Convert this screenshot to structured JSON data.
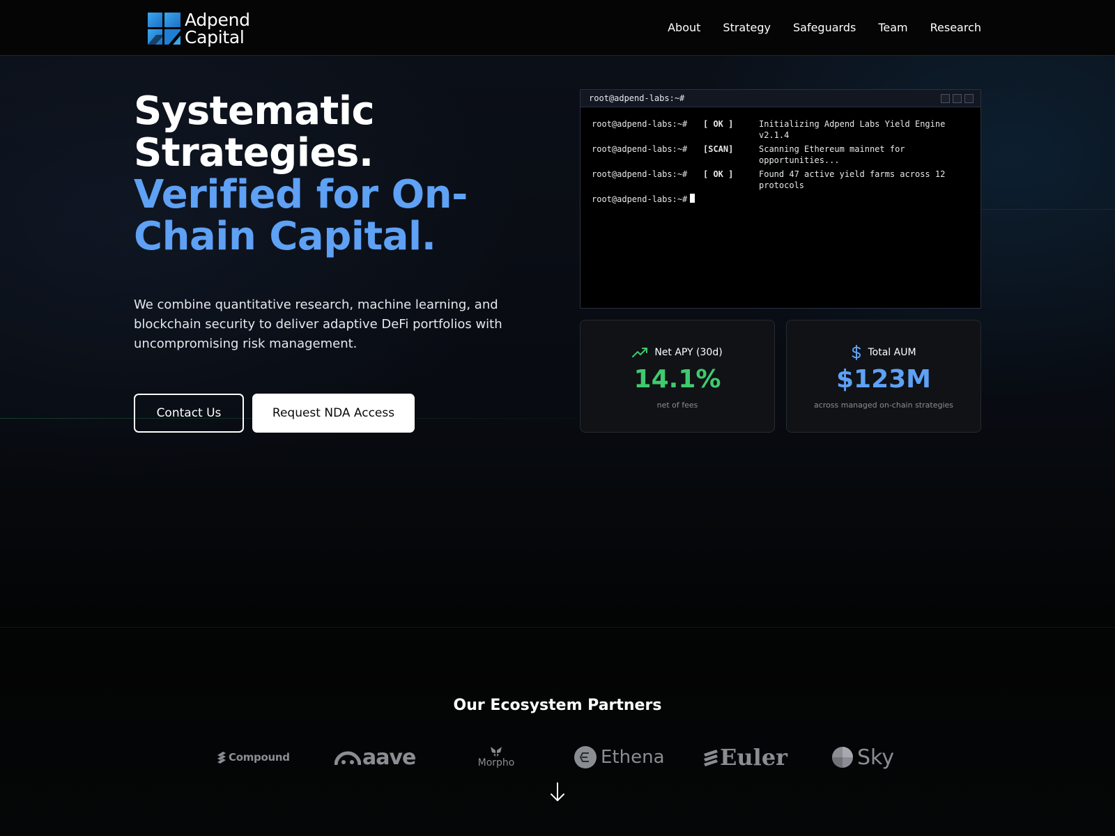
{
  "brand": {
    "name_line1": "Adpend",
    "name_line2": "Capital"
  },
  "nav": {
    "items": [
      "About",
      "Strategy",
      "Safeguards",
      "Team",
      "Research"
    ]
  },
  "hero": {
    "title_line1": "Systematic",
    "title_line2": "Strategies.",
    "title_accent": "Verified for On-Chain Capital.",
    "subtitle": "We combine quantitative research, machine learning, and blockchain security to deliver adaptive DeFi portfolios with uncompromising risk management.",
    "cta_contact": "Contact Us",
    "cta_nda": "Request NDA Access"
  },
  "terminal": {
    "title": "root@adpend-labs:~#",
    "lines": [
      {
        "prompt": "root@adpend-labs:~#",
        "status": "[ OK ]",
        "message": "Initializing Adpend Labs Yield Engine v2.1.4"
      },
      {
        "prompt": "root@adpend-labs:~#",
        "status": "[SCAN]",
        "message": "Scanning Ethereum mainnet for opportunities..."
      },
      {
        "prompt": "root@adpend-labs:~#",
        "status": "[ OK ]",
        "message": "Found 47 active yield farms across 12 protocols"
      }
    ],
    "current_prompt": "root@adpend-labs:~#"
  },
  "stats": {
    "apy": {
      "label": "Net APY (30d)",
      "value": "14.1%",
      "note": "net of fees",
      "icon": "trending-up-icon"
    },
    "aum": {
      "label": "Total AUM",
      "value": "$123M",
      "note": "across managed on-chain strategies",
      "icon": "dollar-icon"
    }
  },
  "partners": {
    "title": "Our Ecosystem Partners",
    "items": [
      "Compound",
      "aave",
      "Morpho",
      "Ethena",
      "Euler",
      "Sky"
    ]
  },
  "colors": {
    "accent_blue": "#5ea1f5",
    "accent_green": "#3ecb6e",
    "background": "#040506",
    "partner_gray": "#8a8d92"
  }
}
